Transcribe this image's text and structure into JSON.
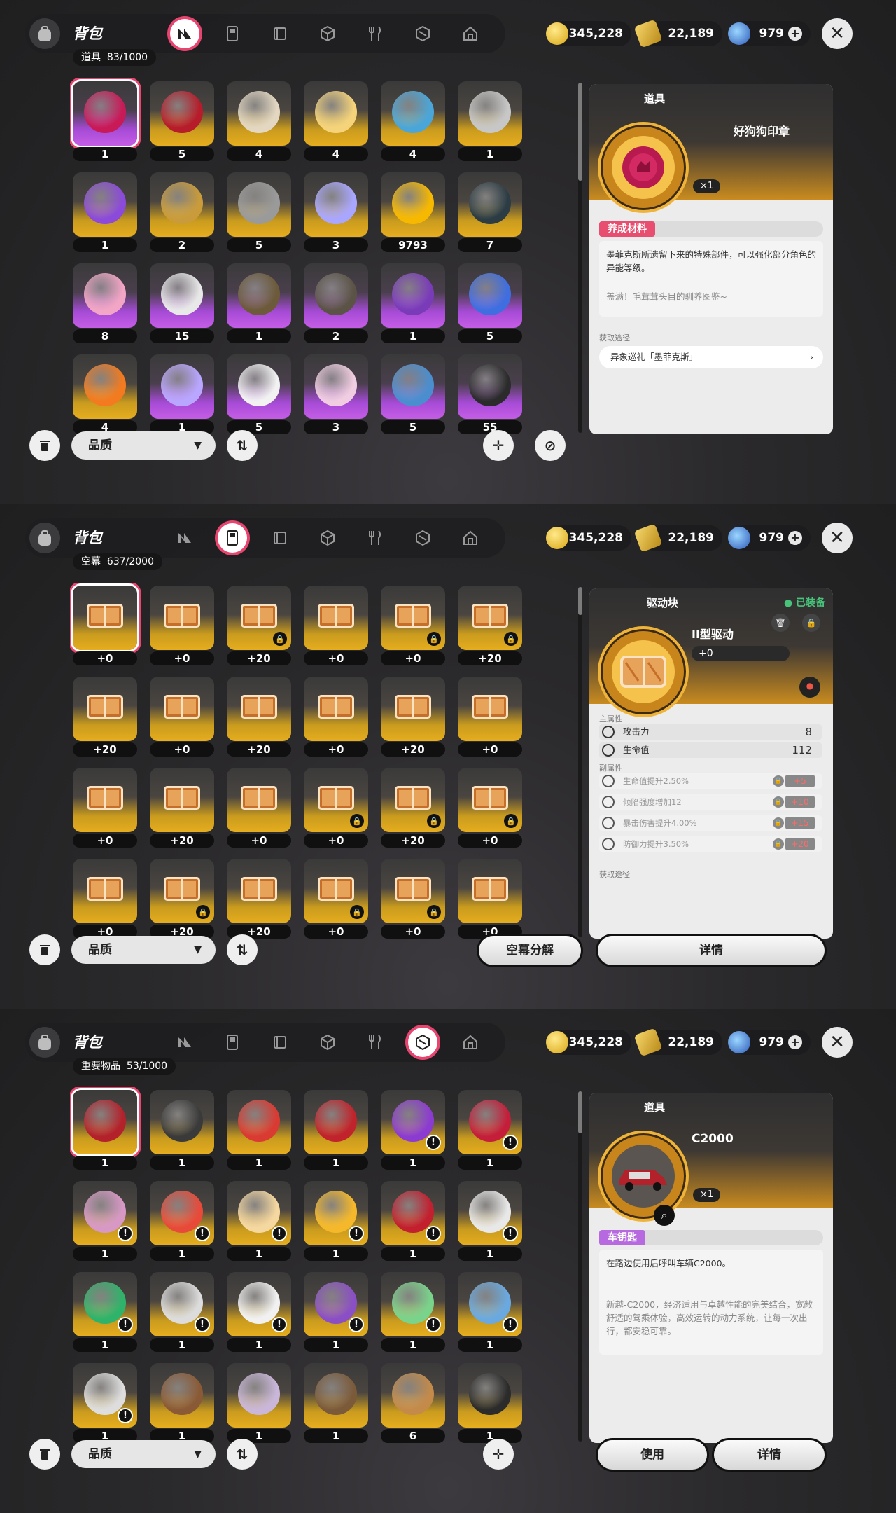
{
  "header": {
    "title": "背包",
    "currency": [
      {
        "icon": "gold-coin-icon",
        "value": "345,228"
      },
      {
        "icon": "ticket-icon",
        "value": "22,189"
      },
      {
        "icon": "gem-icon",
        "value": "979"
      }
    ]
  },
  "colors": {
    "accent_pink": "#e7456f",
    "gold": "#e6ad1e",
    "purple": "#b75ce0"
  },
  "panels": [
    {
      "active_tab": 0,
      "section": {
        "title": "道具",
        "count": "83/1000"
      },
      "items": [
        {
          "icon": "pink-wax-seal-icon",
          "qty": "1",
          "rarity": "purple",
          "selected": true
        },
        {
          "icon": "red-cloak-icon",
          "qty": "5",
          "rarity": "gold"
        },
        {
          "icon": "melting-clock-icon",
          "qty": "4",
          "rarity": "gold"
        },
        {
          "icon": "chess-piece-icon",
          "qty": "4",
          "rarity": "gold"
        },
        {
          "icon": "thread-spool-icon",
          "qty": "4",
          "rarity": "gold"
        },
        {
          "icon": "club-key-icon",
          "qty": "1",
          "rarity": "gold"
        },
        {
          "icon": "purple-blade-icon",
          "qty": "1",
          "rarity": "gold"
        },
        {
          "icon": "gold-belt-icon",
          "qty": "2",
          "rarity": "gold"
        },
        {
          "icon": "armor-chestplate-icon",
          "qty": "5",
          "rarity": "gold"
        },
        {
          "icon": "crystal-shard-icon",
          "qty": "3",
          "rarity": "gold"
        },
        {
          "icon": "pixel-coin-icon",
          "qty": "9793",
          "rarity": "gold"
        },
        {
          "icon": "tpmx-crate-icon",
          "qty": "7",
          "rarity": "gold"
        },
        {
          "icon": "pink-pouch-icon",
          "qty": "8",
          "rarity": "purple"
        },
        {
          "icon": "card-stack-icon",
          "qty": "15",
          "rarity": "purple"
        },
        {
          "icon": "rune-tablet-icon",
          "qty": "1",
          "rarity": "purple"
        },
        {
          "icon": "compass-device-icon",
          "qty": "2",
          "rarity": "purple"
        },
        {
          "icon": "purple-vial-icon",
          "qty": "1",
          "rarity": "purple"
        },
        {
          "icon": "blue-vase-icon",
          "qty": "5",
          "rarity": "purple"
        },
        {
          "icon": "fire-bolt-icon",
          "qty": "4",
          "rarity": "gold"
        },
        {
          "icon": "guitar-pick-icon",
          "qty": "1",
          "rarity": "purple"
        },
        {
          "icon": "white-mask-icon",
          "qty": "5",
          "rarity": "purple"
        },
        {
          "icon": "ticket-stub-icon",
          "qty": "3",
          "rarity": "purple"
        },
        {
          "icon": "dolphin-fountain-icon",
          "qty": "5",
          "rarity": "purple"
        },
        {
          "icon": "gold-board-icon",
          "qty": "55",
          "rarity": "purple"
        }
      ],
      "detail": {
        "category": "道具",
        "name": "好狗狗印章",
        "count": "×1",
        "tag": "养成材料",
        "description": "墨菲克斯所遗留下来的特殊部件，可以强化部分角色的异能等级。",
        "flavor": "盖满！毛茸茸头目的驯养图鉴~",
        "source_label": "获取途径",
        "source": "异象巡礼「墨菲克斯」"
      },
      "sort_label": "品质"
    },
    {
      "active_tab": 1,
      "section": {
        "title": "空幕",
        "count": "637/2000"
      },
      "items": [
        {
          "qty": "+0",
          "locked": false,
          "selected": true
        },
        {
          "qty": "+0",
          "locked": false
        },
        {
          "qty": "+20",
          "locked": true
        },
        {
          "qty": "+0",
          "locked": false
        },
        {
          "qty": "+0",
          "locked": true
        },
        {
          "qty": "+20",
          "locked": true
        },
        {
          "qty": "+20",
          "locked": false
        },
        {
          "qty": "+0",
          "locked": false
        },
        {
          "qty": "+20",
          "locked": false
        },
        {
          "qty": "+0",
          "locked": false
        },
        {
          "qty": "+20",
          "locked": false
        },
        {
          "qty": "+0",
          "locked": false
        },
        {
          "qty": "+0",
          "locked": false
        },
        {
          "qty": "+20",
          "locked": false
        },
        {
          "qty": "+0",
          "locked": false
        },
        {
          "qty": "+0",
          "locked": true
        },
        {
          "qty": "+20",
          "locked": true
        },
        {
          "qty": "+0",
          "locked": true
        },
        {
          "qty": "+0",
          "locked": false
        },
        {
          "qty": "+20",
          "locked": true
        },
        {
          "qty": "+20",
          "locked": false
        },
        {
          "qty": "+0",
          "locked": true
        },
        {
          "qty": "+0",
          "locked": true
        },
        {
          "qty": "+0",
          "locked": false
        }
      ],
      "detail": {
        "category": "驱动块",
        "equipped": "已装备",
        "name": "II型驱动",
        "level": "+0",
        "main_label": "主属性",
        "main_stats": [
          {
            "name": "攻击力",
            "value": "8"
          },
          {
            "name": "生命值",
            "value": "112"
          }
        ],
        "sub_label": "副属性",
        "sub_stats": [
          {
            "name": "生命值提升2.50%",
            "bonus": "+5"
          },
          {
            "name": "倾陷强度增加12",
            "bonus": "+10"
          },
          {
            "name": "暴击伤害提升4.00%",
            "bonus": "+15"
          },
          {
            "name": "防御力提升3.50%",
            "bonus": "+20"
          }
        ],
        "source_label": "获取途径"
      },
      "sort_label": "品质",
      "buttons": {
        "decompose": "空幕分解",
        "details": "详情"
      }
    },
    {
      "active_tab": 5,
      "section": {
        "title": "重要物品",
        "count": "53/1000"
      },
      "items": [
        {
          "icon": "red-car-icon",
          "qty": "1",
          "selected": true
        },
        {
          "icon": "motorbike-icon",
          "qty": "1"
        },
        {
          "icon": "red-scooter-icon",
          "qty": "1"
        },
        {
          "icon": "red-sportbike-icon",
          "qty": "1"
        },
        {
          "icon": "purple-slime-icon",
          "qty": "1",
          "alert": true
        },
        {
          "icon": "rose-bouquet-icon",
          "qty": "1",
          "alert": true
        },
        {
          "icon": "pearl-shell-icon",
          "qty": "1",
          "alert": true
        },
        {
          "icon": "drink-bag-icon",
          "qty": "1",
          "alert": true
        },
        {
          "icon": "ice-cream-icon",
          "qty": "1",
          "alert": true
        },
        {
          "icon": "french-fries-icon",
          "qty": "1",
          "alert": true
        },
        {
          "icon": "wine-bottle-icon",
          "qty": "1",
          "alert": true
        },
        {
          "icon": "delivery-truck-icon",
          "qty": "1",
          "alert": true
        },
        {
          "icon": "green-orb-icon",
          "qty": "1",
          "alert": true
        },
        {
          "icon": "cloud-figure-icon",
          "qty": "1",
          "alert": true
        },
        {
          "icon": "document-icon",
          "qty": "1",
          "alert": true
        },
        {
          "icon": "test-tube-icon",
          "qty": "1",
          "alert": true
        },
        {
          "icon": "star-wand-icon",
          "qty": "1",
          "alert": true
        },
        {
          "icon": "id-card-icon",
          "qty": "1",
          "alert": true
        },
        {
          "icon": "matchstick-icon",
          "qty": "1",
          "alert": true
        },
        {
          "icon": "leather-wallet-icon",
          "qty": "1"
        },
        {
          "icon": "character-poster-icon",
          "qty": "1"
        },
        {
          "icon": "vine-wreath-icon",
          "qty": "1"
        },
        {
          "icon": "bronze-coin-icon",
          "qty": "6"
        },
        {
          "icon": "photo-frame-icon",
          "qty": "1"
        }
      ],
      "detail": {
        "category": "道具",
        "name": "C2000",
        "count": "×1",
        "tag": "车钥匙",
        "description": "在路边使用后呼叫车辆C2000。",
        "flavor": "新越-C2000，经济适用与卓越性能的完美结合，宽敞舒适的驾乘体验，高效运转的动力系统，让每一次出行，都安稳可靠。"
      },
      "sort_label": "品质",
      "buttons": {
        "use": "使用",
        "details": "详情"
      }
    }
  ]
}
